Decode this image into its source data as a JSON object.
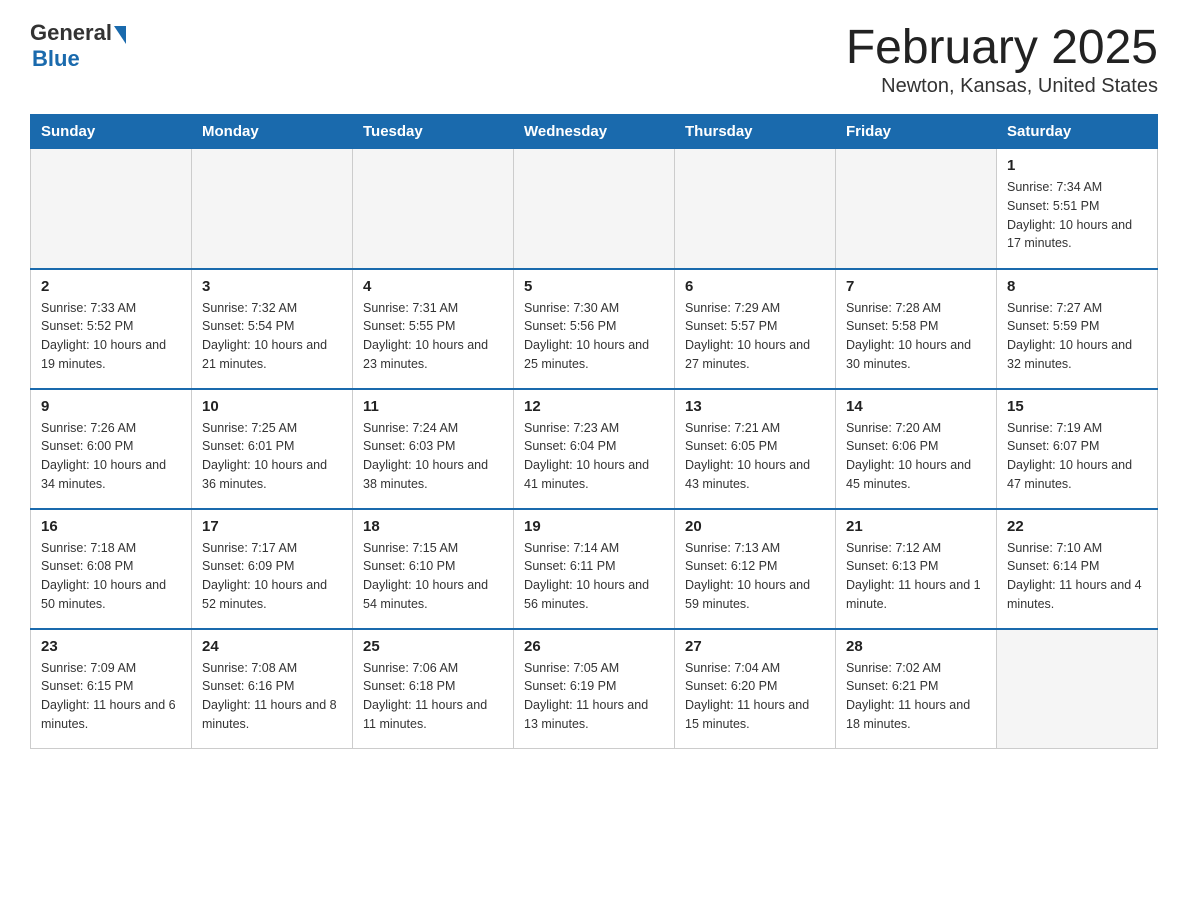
{
  "header": {
    "logo_general": "General",
    "logo_blue": "Blue",
    "title": "February 2025",
    "subtitle": "Newton, Kansas, United States"
  },
  "weekdays": [
    "Sunday",
    "Monday",
    "Tuesday",
    "Wednesday",
    "Thursday",
    "Friday",
    "Saturday"
  ],
  "weeks": [
    [
      {
        "day": "",
        "info": ""
      },
      {
        "day": "",
        "info": ""
      },
      {
        "day": "",
        "info": ""
      },
      {
        "day": "",
        "info": ""
      },
      {
        "day": "",
        "info": ""
      },
      {
        "day": "",
        "info": ""
      },
      {
        "day": "1",
        "info": "Sunrise: 7:34 AM\nSunset: 5:51 PM\nDaylight: 10 hours and 17 minutes."
      }
    ],
    [
      {
        "day": "2",
        "info": "Sunrise: 7:33 AM\nSunset: 5:52 PM\nDaylight: 10 hours and 19 minutes."
      },
      {
        "day": "3",
        "info": "Sunrise: 7:32 AM\nSunset: 5:54 PM\nDaylight: 10 hours and 21 minutes."
      },
      {
        "day": "4",
        "info": "Sunrise: 7:31 AM\nSunset: 5:55 PM\nDaylight: 10 hours and 23 minutes."
      },
      {
        "day": "5",
        "info": "Sunrise: 7:30 AM\nSunset: 5:56 PM\nDaylight: 10 hours and 25 minutes."
      },
      {
        "day": "6",
        "info": "Sunrise: 7:29 AM\nSunset: 5:57 PM\nDaylight: 10 hours and 27 minutes."
      },
      {
        "day": "7",
        "info": "Sunrise: 7:28 AM\nSunset: 5:58 PM\nDaylight: 10 hours and 30 minutes."
      },
      {
        "day": "8",
        "info": "Sunrise: 7:27 AM\nSunset: 5:59 PM\nDaylight: 10 hours and 32 minutes."
      }
    ],
    [
      {
        "day": "9",
        "info": "Sunrise: 7:26 AM\nSunset: 6:00 PM\nDaylight: 10 hours and 34 minutes."
      },
      {
        "day": "10",
        "info": "Sunrise: 7:25 AM\nSunset: 6:01 PM\nDaylight: 10 hours and 36 minutes."
      },
      {
        "day": "11",
        "info": "Sunrise: 7:24 AM\nSunset: 6:03 PM\nDaylight: 10 hours and 38 minutes."
      },
      {
        "day": "12",
        "info": "Sunrise: 7:23 AM\nSunset: 6:04 PM\nDaylight: 10 hours and 41 minutes."
      },
      {
        "day": "13",
        "info": "Sunrise: 7:21 AM\nSunset: 6:05 PM\nDaylight: 10 hours and 43 minutes."
      },
      {
        "day": "14",
        "info": "Sunrise: 7:20 AM\nSunset: 6:06 PM\nDaylight: 10 hours and 45 minutes."
      },
      {
        "day": "15",
        "info": "Sunrise: 7:19 AM\nSunset: 6:07 PM\nDaylight: 10 hours and 47 minutes."
      }
    ],
    [
      {
        "day": "16",
        "info": "Sunrise: 7:18 AM\nSunset: 6:08 PM\nDaylight: 10 hours and 50 minutes."
      },
      {
        "day": "17",
        "info": "Sunrise: 7:17 AM\nSunset: 6:09 PM\nDaylight: 10 hours and 52 minutes."
      },
      {
        "day": "18",
        "info": "Sunrise: 7:15 AM\nSunset: 6:10 PM\nDaylight: 10 hours and 54 minutes."
      },
      {
        "day": "19",
        "info": "Sunrise: 7:14 AM\nSunset: 6:11 PM\nDaylight: 10 hours and 56 minutes."
      },
      {
        "day": "20",
        "info": "Sunrise: 7:13 AM\nSunset: 6:12 PM\nDaylight: 10 hours and 59 minutes."
      },
      {
        "day": "21",
        "info": "Sunrise: 7:12 AM\nSunset: 6:13 PM\nDaylight: 11 hours and 1 minute."
      },
      {
        "day": "22",
        "info": "Sunrise: 7:10 AM\nSunset: 6:14 PM\nDaylight: 11 hours and 4 minutes."
      }
    ],
    [
      {
        "day": "23",
        "info": "Sunrise: 7:09 AM\nSunset: 6:15 PM\nDaylight: 11 hours and 6 minutes."
      },
      {
        "day": "24",
        "info": "Sunrise: 7:08 AM\nSunset: 6:16 PM\nDaylight: 11 hours and 8 minutes."
      },
      {
        "day": "25",
        "info": "Sunrise: 7:06 AM\nSunset: 6:18 PM\nDaylight: 11 hours and 11 minutes."
      },
      {
        "day": "26",
        "info": "Sunrise: 7:05 AM\nSunset: 6:19 PM\nDaylight: 11 hours and 13 minutes."
      },
      {
        "day": "27",
        "info": "Sunrise: 7:04 AM\nSunset: 6:20 PM\nDaylight: 11 hours and 15 minutes."
      },
      {
        "day": "28",
        "info": "Sunrise: 7:02 AM\nSunset: 6:21 PM\nDaylight: 11 hours and 18 minutes."
      },
      {
        "day": "",
        "info": ""
      }
    ]
  ]
}
